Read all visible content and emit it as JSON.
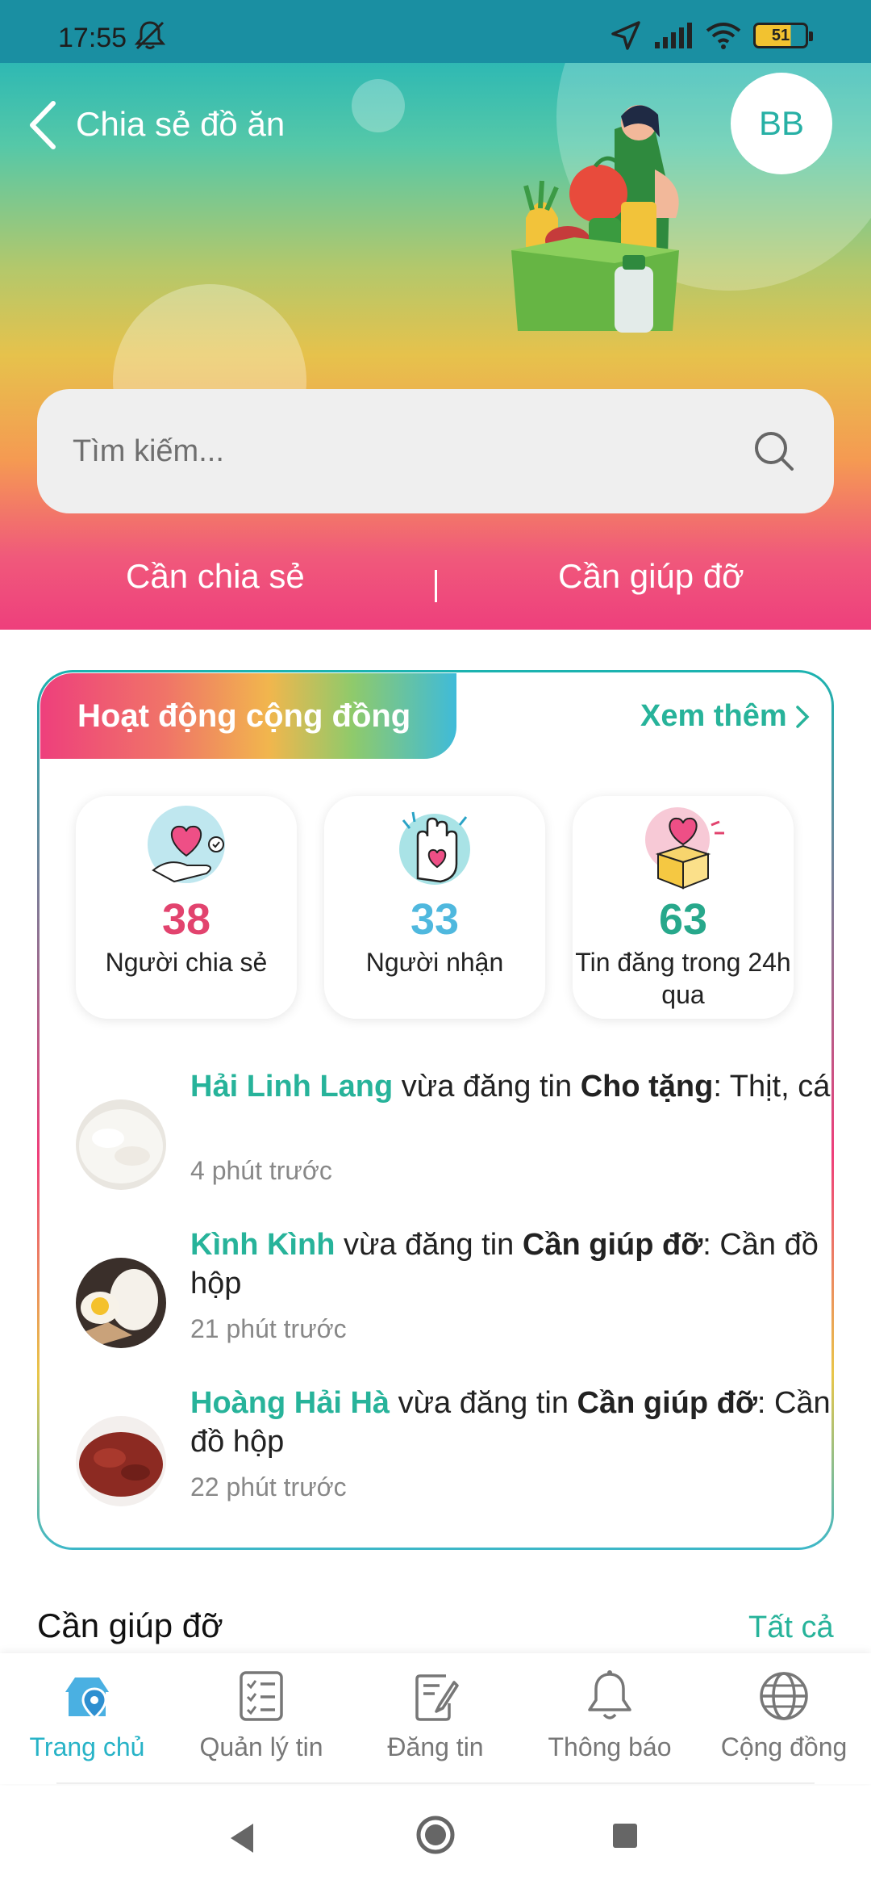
{
  "status_bar": {
    "time": "17:55",
    "battery": "51"
  },
  "header": {
    "title": "Chia sẻ đồ ăn",
    "avatar_initials": "BB"
  },
  "search": {
    "placeholder": "Tìm kiếm..."
  },
  "tabs": [
    {
      "label": "Cần chia sẻ"
    },
    {
      "label": "Cần giúp đỡ"
    }
  ],
  "community": {
    "title": "Hoạt động cộng đồng",
    "see_more": "Xem thêm",
    "stats": [
      {
        "value": "38",
        "label": "Người chia sẻ",
        "color": "#e2436e"
      },
      {
        "value": "33",
        "label": "Người nhận",
        "color": "#4fb8de"
      },
      {
        "value": "63",
        "label": "Tin đăng trong 24h qua",
        "color": "#27a88b"
      }
    ],
    "activities": [
      {
        "name": "Hải Linh Lang",
        "verb": " vừa đăng tin ",
        "kind": "Cho tặng",
        "detail": ": Thịt, cá",
        "time": "4 phút trước"
      },
      {
        "name": "Kình Kình",
        "verb": " vừa đăng tin ",
        "kind": "Cần giúp đỡ",
        "detail": ": Cần đồ hộp",
        "time": "21 phút trước"
      },
      {
        "name": "Hoàng Hải Hà",
        "verb": " vừa đăng tin ",
        "kind": "Cần giúp đỡ",
        "detail": ": Cần đồ hộp",
        "time": "22 phút trước"
      }
    ]
  },
  "section": {
    "title": "Cần giúp đỡ",
    "all": "Tất cả"
  },
  "bottom_nav": [
    {
      "label": "Trang chủ",
      "icon": "home-location-icon",
      "active": true
    },
    {
      "label": "Quản lý tin",
      "icon": "checklist-icon",
      "active": false
    },
    {
      "label": "Đăng tin",
      "icon": "edit-post-icon",
      "active": false
    },
    {
      "label": "Thông báo",
      "icon": "bell-icon",
      "active": false
    },
    {
      "label": "Cộng đồng",
      "icon": "globe-icon",
      "active": false
    }
  ],
  "colors": {
    "accent": "#27b39a",
    "nav_active": "#27b3c7",
    "pink": "#ee3f7c"
  }
}
